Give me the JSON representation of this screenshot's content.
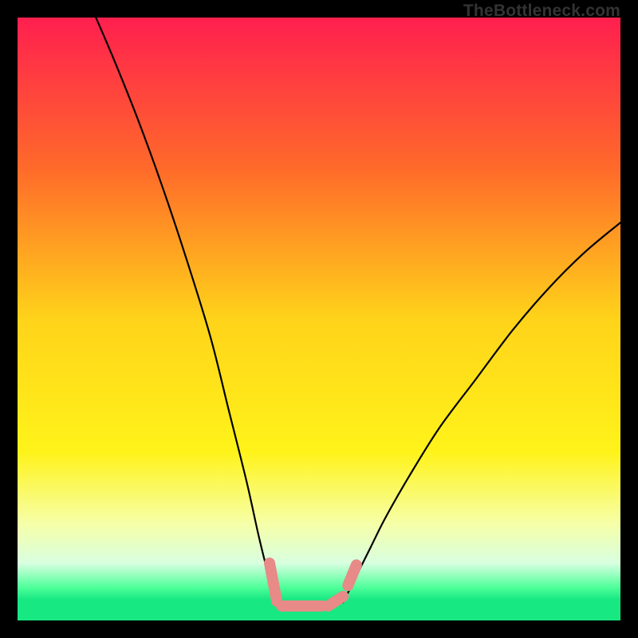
{
  "watermark": "TheBottleneck.com",
  "chart_data": {
    "type": "line",
    "title": "",
    "xlabel": "",
    "ylabel": "",
    "xlim": [
      0,
      100
    ],
    "ylim": [
      0,
      100
    ],
    "gradient_stops": [
      {
        "pos": 0.0,
        "color": "#ff1f4f"
      },
      {
        "pos": 0.25,
        "color": "#ff6a2a"
      },
      {
        "pos": 0.5,
        "color": "#ffd31a"
      },
      {
        "pos": 0.72,
        "color": "#fff31a"
      },
      {
        "pos": 0.84,
        "color": "#f6ffa8"
      },
      {
        "pos": 0.905,
        "color": "#d8ffe0"
      },
      {
        "pos": 0.945,
        "color": "#4fff9a"
      },
      {
        "pos": 0.965,
        "color": "#18e882"
      },
      {
        "pos": 1.0,
        "color": "#18e882"
      }
    ],
    "series": [
      {
        "name": "left-curve",
        "x": [
          13,
          16,
          20,
          24,
          28,
          32,
          35,
          38,
          40,
          41.5,
          42.5,
          43
        ],
        "y": [
          100,
          93,
          83,
          72,
          60,
          47,
          35,
          23,
          14,
          8,
          5,
          3
        ]
      },
      {
        "name": "right-curve",
        "x": [
          54,
          55,
          56.5,
          58.5,
          61,
          65,
          70,
          76,
          82,
          88,
          94,
          100
        ],
        "y": [
          3,
          5,
          8,
          12,
          17,
          24,
          32,
          40,
          48,
          55,
          61,
          66
        ]
      }
    ],
    "bottom_markers": {
      "color": "#e88a87",
      "segments": [
        {
          "x0": 41.8,
          "y0": 9.5,
          "x1": 43.0,
          "y1": 3.2
        },
        {
          "x0": 43.8,
          "y0": 2.4,
          "x1": 50.5,
          "y1": 2.4
        },
        {
          "x0": 51.5,
          "y0": 2.4,
          "x1": 54.0,
          "y1": 4.0
        },
        {
          "x0": 54.8,
          "y0": 5.8,
          "x1": 56.2,
          "y1": 9.2
        }
      ]
    }
  }
}
